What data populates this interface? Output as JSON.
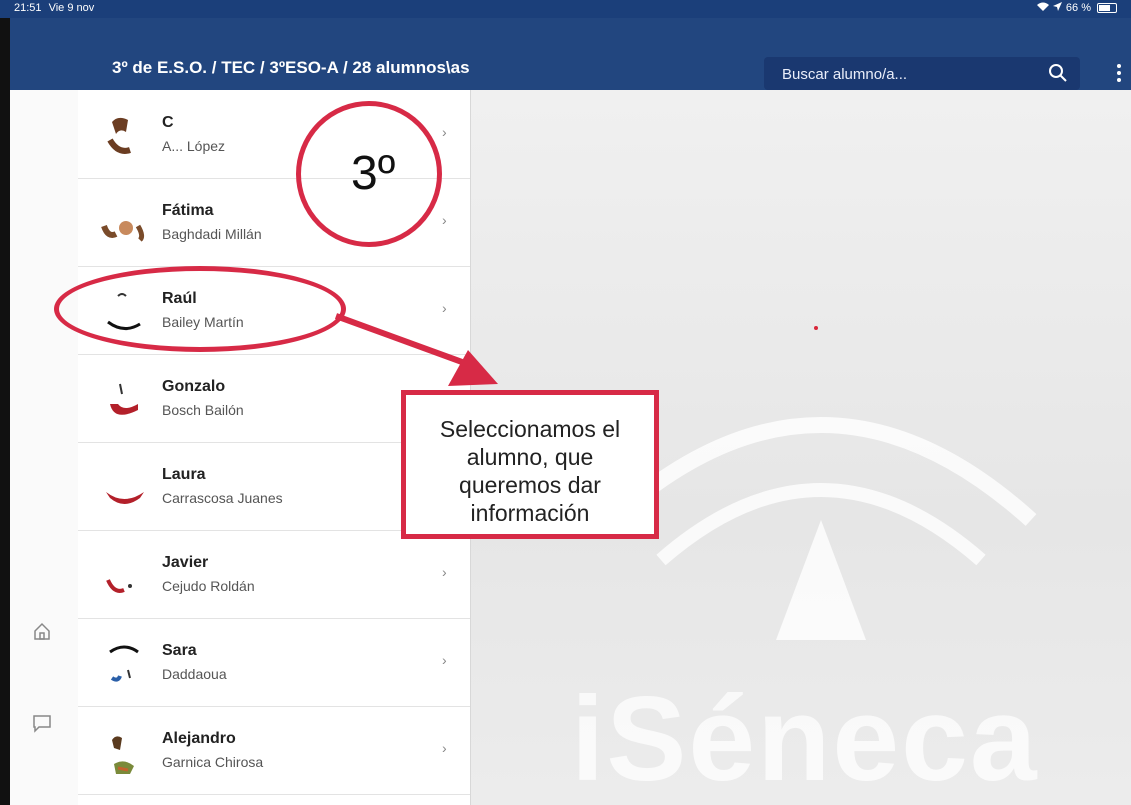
{
  "status_bar": {
    "time": "21:51",
    "date": "Vie 9 nov",
    "battery": "66 %",
    "battery_level": 0.66
  },
  "header": {
    "breadcrumb": "3º de E.S.O. / TEC / 3ºESO-A / 28 alumnos\\as",
    "search_placeholder": "Buscar alumno/a...",
    "icons": {
      "search": "search-icon",
      "menu": "more-vertical-icon"
    }
  },
  "sidenav": {
    "icons": [
      "home-icon",
      "chat-icon"
    ]
  },
  "students": [
    {
      "first": "C",
      "last": "A... López",
      "chevron": "›"
    },
    {
      "first": "Fátima",
      "last": "Baghdadi Millán",
      "chevron": "›"
    },
    {
      "first": "Raúl",
      "last": "Bailey Martín",
      "chevron": "›"
    },
    {
      "first": "Gonzalo",
      "last": "Bosch Bailón",
      "chevron": "›"
    },
    {
      "first": "Laura",
      "last": "Carrascosa Juanes",
      "chevron": "›"
    },
    {
      "first": "Javier",
      "last": "Cejudo Roldán",
      "chevron": "›"
    },
    {
      "first": "Sara",
      "last": "Daddaoua",
      "chevron": "›"
    },
    {
      "first": "Alejandro",
      "last": "Garnica Chirosa",
      "chevron": "›"
    }
  ],
  "annotations": {
    "circle_text": "3º",
    "box_lines": [
      "Seleccionamos el",
      "alumno, que",
      "queremos dar",
      "información"
    ],
    "color": "#d72a46"
  },
  "watermark": "iSéneca",
  "colors": {
    "header": "#22467f",
    "status_bar": "#1b3f7a",
    "annotation": "#d72a46"
  }
}
